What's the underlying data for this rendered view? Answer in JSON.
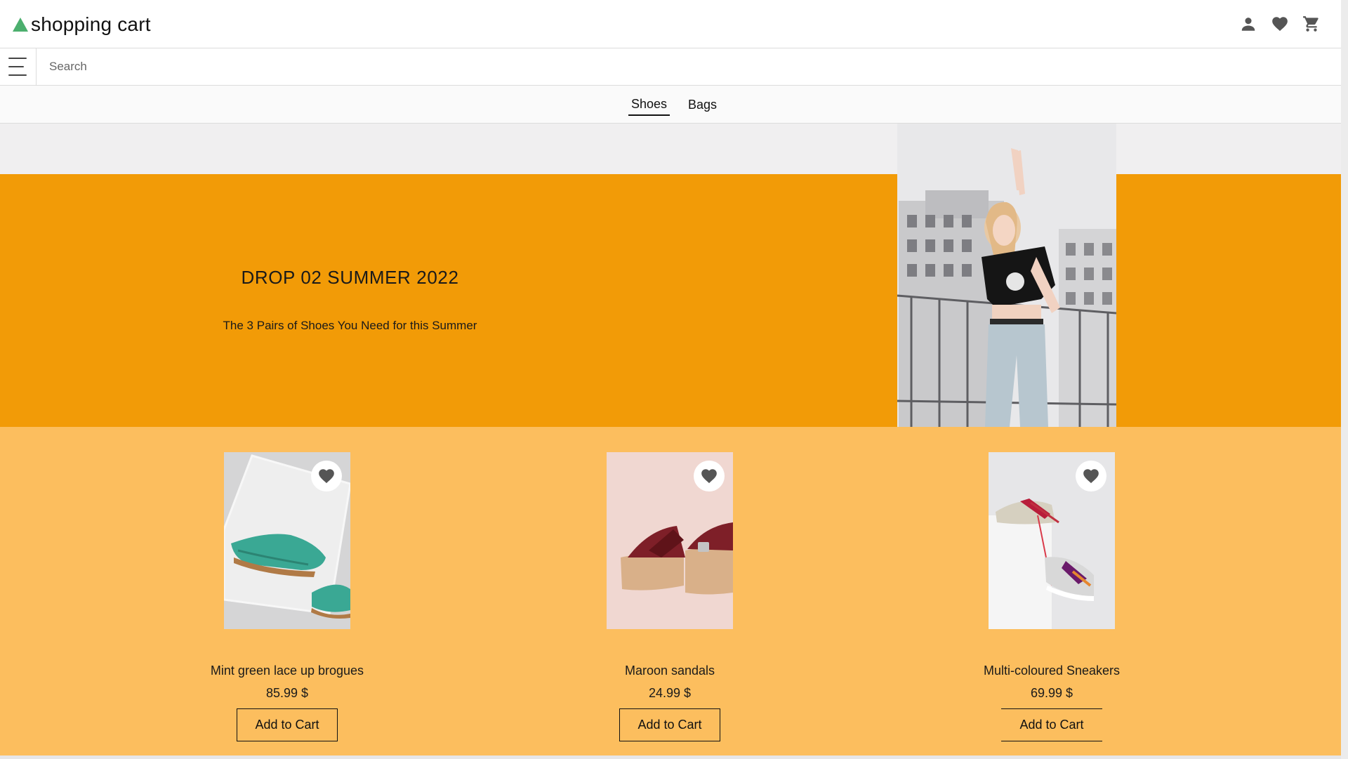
{
  "header": {
    "title": "shopping cart",
    "logo_icon": "triangle-logo-icon",
    "logo_color": "#4caf6e",
    "icons": [
      "user-icon",
      "heart-icon",
      "cart-icon"
    ]
  },
  "search": {
    "placeholder": "Search",
    "value": "",
    "menu_icon": "hamburger-menu-icon"
  },
  "tabs": [
    {
      "label": "Shoes",
      "active": true
    },
    {
      "label": "Bags",
      "active": false
    }
  ],
  "hero": {
    "heading": "DROP 02 SUMMER 2022",
    "subheading": "The 3 Pairs of Shoes You Need for this Summer",
    "background_color": "#f29b07"
  },
  "products": [
    {
      "name": "Mint green lace up brogues",
      "price": "85.99 $",
      "button_label": "Add to Cart"
    },
    {
      "name": "Maroon sandals",
      "price": "24.99 $",
      "button_label": "Add to Cart"
    },
    {
      "name": "Multi-coloured Sneakers",
      "price": "69.99 $",
      "button_label": "Add to Cart"
    }
  ],
  "colors": {
    "products_background": "#fcbe5e",
    "hero_top_background": "#f0eff0"
  }
}
